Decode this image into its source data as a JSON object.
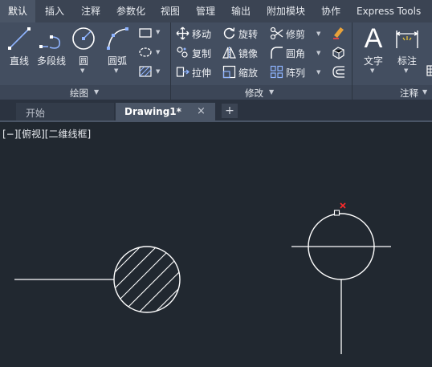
{
  "ribbon_tabs": [
    "默认",
    "插入",
    "注释",
    "参数化",
    "视图",
    "管理",
    "输出",
    "附加模块",
    "协作",
    "Express Tools"
  ],
  "draw_panel": {
    "title": "绘图",
    "line": "直线",
    "polyline": "多段线",
    "circle": "圆",
    "arc": "圆弧"
  },
  "modify_panel": {
    "title": "修改",
    "move": "移动",
    "rotate": "旋转",
    "trim": "修剪",
    "copy": "复制",
    "mirror": "镜像",
    "fillet": "圆角",
    "stretch": "拉伸",
    "scale": "缩放",
    "array": "阵列"
  },
  "annotation_panel": {
    "title": "注释",
    "text": "文字",
    "dimension": "标注"
  },
  "doc_tabs": {
    "start": "开始",
    "drawing": "Drawing1*",
    "close": "×",
    "new": "+"
  },
  "viewport_label": {
    "controls": "[−]",
    "view": "[俯视]",
    "style": "[二维线框]"
  },
  "colors": {
    "background": "#212830",
    "ribbon": "#434e60",
    "grip": "#ff2a2a",
    "geometry": "#ffffff"
  }
}
